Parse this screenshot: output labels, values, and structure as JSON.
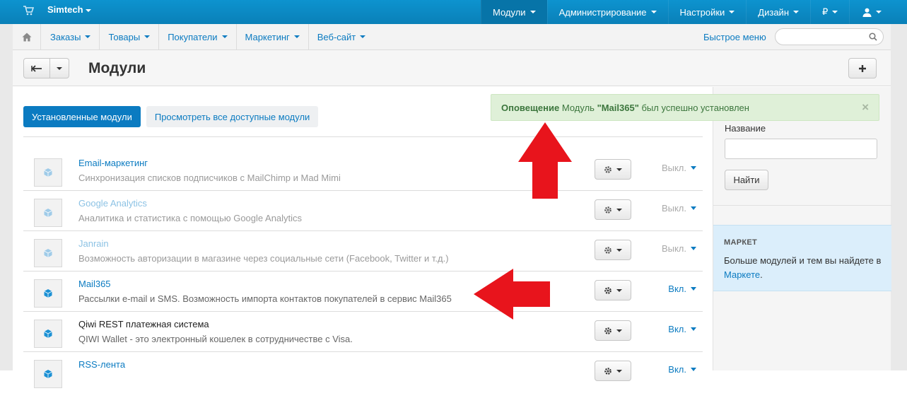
{
  "topbar": {
    "brand": "Simtech",
    "nav": [
      {
        "label": "Модули",
        "active": true
      },
      {
        "label": "Администрирование",
        "active": false
      },
      {
        "label": "Настройки",
        "active": false
      },
      {
        "label": "Дизайн",
        "active": false
      },
      {
        "label": "₽",
        "active": false
      },
      {
        "label": "",
        "active": false,
        "icon": "user-icon"
      }
    ]
  },
  "subnav": {
    "items": [
      "Заказы",
      "Товары",
      "Покупатели",
      "Маркетинг",
      "Веб-сайт"
    ],
    "quick_menu": "Быстрое меню",
    "search_placeholder": ""
  },
  "title": "Модули",
  "tabs": [
    "Установленные модули",
    "Просмотреть все доступные модули"
  ],
  "alert": {
    "label": "Оповещение",
    "text_before": "Модуль ",
    "addon": "\"Mail365\"",
    "text_after": " был успешно установлен",
    "close": "×"
  },
  "addons": [
    {
      "name": "Email-маркетинг",
      "desc": "Синхронизация списков подписчиков с MailChimp и Mad Mimi",
      "status": "Выкл.",
      "enabled": false
    },
    {
      "name": "Google Analytics",
      "desc": "Аналитика и статистика с помощью Google Analytics",
      "status": "Выкл.",
      "enabled": false
    },
    {
      "name": "Janrain",
      "desc": "Возможность авторизации в магазине через социальные сети (Facebook, Twitter и т.д.)",
      "status": "Выкл.",
      "enabled": false
    },
    {
      "name": "Mail365",
      "desc": "Рассылки e-mail и SMS. Возможность импорта контактов покупателей в сервис Mail365",
      "status": "Вкл.",
      "enabled": true
    },
    {
      "name": "Qiwi REST платежная система",
      "desc": "QIWI Wallet - это электронный кошелек в сотрудничестве с Visa.",
      "status": "Вкл.",
      "enabled": true
    },
    {
      "name": "RSS-лента",
      "desc": "",
      "status": "Вкл.",
      "enabled": true
    }
  ],
  "sidebar": {
    "name_label": "Название",
    "find_button": "Найти",
    "market_title": "МАРКЕТ",
    "market_text": "Больше модулей и тем вы найдете в ",
    "market_link": "Маркете",
    "market_end": "."
  },
  "colors": {
    "topbar": "#0d93cf",
    "link": "#0b7bc1",
    "alert_bg": "#dff0d8",
    "arrow": "#e8141c"
  }
}
